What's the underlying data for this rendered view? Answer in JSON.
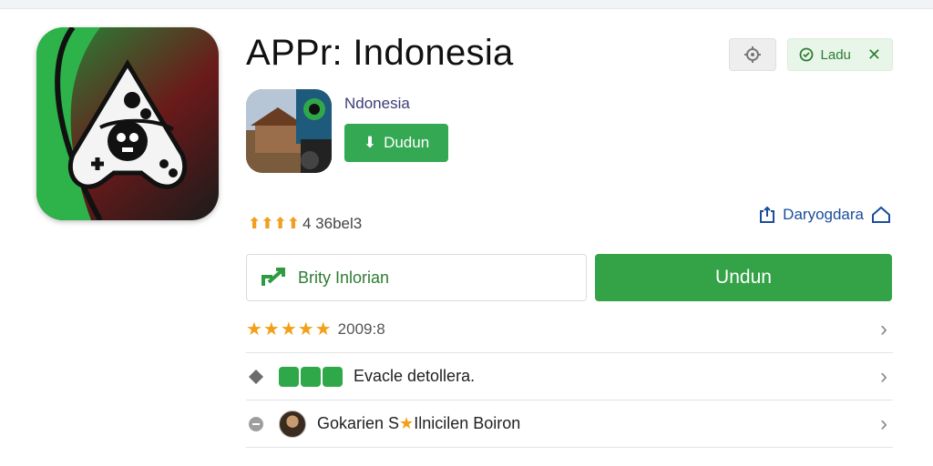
{
  "app": {
    "title": "APPr: Indonesia",
    "developer": "Ndonesia",
    "small_download_label": "Dudun",
    "rating_text": "4 36bel3",
    "share_label": "Daryogdara",
    "secondary_button_label": "Brity Inlorian",
    "primary_button_label": "Undun"
  },
  "top_actions": {
    "settings_icon": "settings-gear-icon",
    "status_label": "Ladu"
  },
  "list": {
    "rows": [
      {
        "meta": "2009:8",
        "icon": "star-rating"
      },
      {
        "label": "Evacle detollera.",
        "icon": "info-icon"
      },
      {
        "name_part1": "Gokarien S",
        "name_part2": "Ilnicilen Boiron",
        "icon": "chat-icon"
      }
    ]
  },
  "colors": {
    "brand_green": "#34a347",
    "star_orange": "#f2a017",
    "link_blue": "#1a4d9c"
  }
}
